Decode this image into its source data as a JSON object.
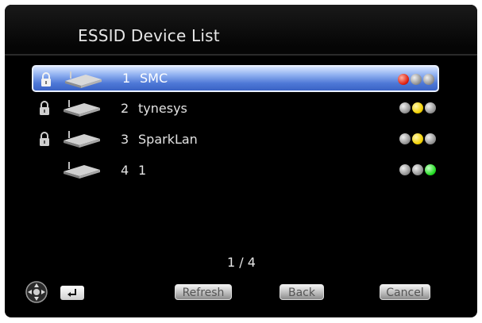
{
  "screen": {
    "title": "ESSID Device List"
  },
  "devices": [
    {
      "number": "1",
      "name": "SMC",
      "locked": true,
      "selected": true,
      "signal": [
        "red",
        "grey",
        "grey"
      ]
    },
    {
      "number": "2",
      "name": "tynesys",
      "locked": true,
      "selected": false,
      "signal": [
        "grey",
        "yellow",
        "grey"
      ]
    },
    {
      "number": "3",
      "name": "SparkLan",
      "locked": true,
      "selected": false,
      "signal": [
        "grey",
        "yellow",
        "grey"
      ]
    },
    {
      "number": "4",
      "name": "1",
      "locked": false,
      "selected": false,
      "signal": [
        "grey",
        "grey",
        "green"
      ]
    }
  ],
  "pager": "1 / 4",
  "footer": {
    "refresh_label": "Refresh",
    "back_label": "Back",
    "cancel_label": "Cancel",
    "nav_icon": "dpad-icon",
    "return_icon": "return-arrow-icon"
  },
  "colors": {
    "background": "#000000",
    "selection": "#4e78d6",
    "led_red": "#e02010",
    "led_yellow": "#f2d000",
    "led_green": "#22dd22"
  }
}
